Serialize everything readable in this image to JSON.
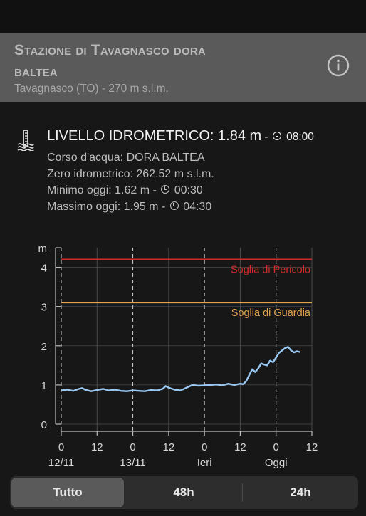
{
  "station": {
    "title_line1": "Stazione di Tavagnasco dora",
    "title_line2": "baltea",
    "subtitle": "Tavagnasco (TO) - 270 m s.l.m."
  },
  "level": {
    "label": "LIVELLO IDROMETRICO: 1.84 m",
    "separator": " - ",
    "time": "08:00",
    "river": "Corso d'acqua: DORA BALTEA",
    "zero": "Zero idrometrico: 262.52 m s.l.m.",
    "min_label": "Minimo oggi: 1.62 m - ",
    "min_time": "00:30",
    "max_label": "Massimo oggi: 1.95 m - ",
    "max_time": "04:30"
  },
  "icons": {
    "gauge": "water-gauge-icon",
    "info": "info-icon",
    "clock": "clock-icon"
  },
  "colors": {
    "danger": "#d42a2a",
    "warning": "#e3a34e",
    "series": "#99c8f2",
    "header_bg": "#5a5a5a"
  },
  "chart_data": {
    "type": "line",
    "ylabel": "m",
    "ylim": [
      0,
      4.5
    ],
    "yticks": [
      0,
      1,
      2,
      3,
      4
    ],
    "xlim": [
      0,
      84
    ],
    "xticks": [
      {
        "h": 0,
        "label": "0",
        "sub": "12/11"
      },
      {
        "h": 12,
        "label": "12",
        "sub": ""
      },
      {
        "h": 24,
        "label": "0",
        "sub": "13/11"
      },
      {
        "h": 36,
        "label": "12",
        "sub": ""
      },
      {
        "h": 48,
        "label": "0",
        "sub": "Ieri"
      },
      {
        "h": 60,
        "label": "12",
        "sub": ""
      },
      {
        "h": 72,
        "label": "0",
        "sub": "Oggi"
      },
      {
        "h": 84,
        "label": "12",
        "sub": ""
      }
    ],
    "day_lines": [
      0,
      24,
      48,
      72
    ],
    "thresholds": [
      {
        "name": "Soglia di Pericolo",
        "value": 4.2,
        "color": "#d42a2a"
      },
      {
        "name": "Soglia di Guardia",
        "value": 3.1,
        "color": "#e3a34e"
      }
    ],
    "series": [
      {
        "x": [
          0,
          2,
          4,
          6,
          7,
          8,
          10,
          12,
          14,
          16,
          18,
          20,
          22,
          24,
          26,
          28,
          30,
          32,
          34,
          35,
          36,
          38,
          40,
          42,
          44,
          46,
          48,
          50,
          52,
          54,
          56,
          58,
          60,
          61,
          62,
          63,
          64,
          65,
          66,
          67,
          68,
          69,
          70,
          71,
          72,
          73,
          74,
          75,
          76,
          77,
          78,
          79,
          80
        ],
        "y": [
          0.86,
          0.88,
          0.85,
          0.9,
          0.92,
          0.88,
          0.84,
          0.87,
          0.9,
          0.86,
          0.88,
          0.85,
          0.84,
          0.86,
          0.85,
          0.84,
          0.87,
          0.86,
          0.9,
          0.97,
          0.93,
          0.88,
          0.86,
          0.93,
          1.0,
          0.98,
          0.99,
          1.0,
          1.01,
          0.99,
          1.03,
          1.0,
          1.03,
          1.02,
          1.1,
          1.25,
          1.4,
          1.33,
          1.42,
          1.55,
          1.52,
          1.5,
          1.62,
          1.58,
          1.7,
          1.82,
          1.88,
          1.94,
          1.97,
          1.88,
          1.83,
          1.86,
          1.84
        ]
      }
    ]
  },
  "tabs": [
    "Tutto",
    "48h",
    "24h"
  ],
  "active_tab": 0
}
